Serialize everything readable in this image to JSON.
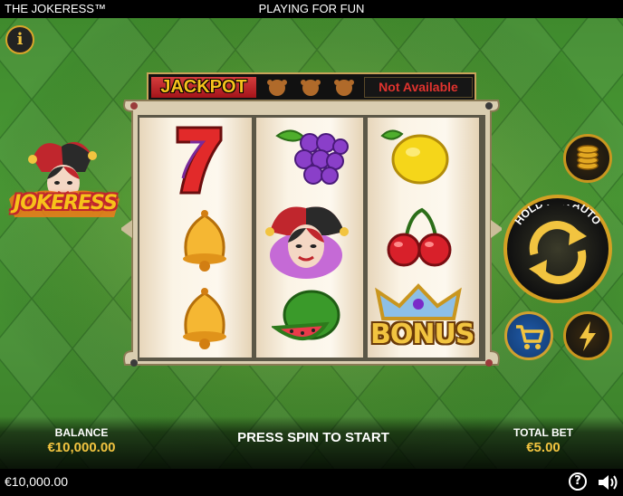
{
  "header": {
    "game_title": "THE JOKERESS™",
    "mode_label": "PLAYING FOR FUN"
  },
  "info_button": {
    "icon": "info-icon",
    "glyph": "i"
  },
  "logo": {
    "text": "JOKERESS",
    "prefix": ""
  },
  "jackpot": {
    "label": "JACKPOT",
    "status": "Not Available"
  },
  "reels": [
    [
      "seven",
      "bell",
      "bell"
    ],
    [
      "grapes",
      "jokeress",
      "watermelon"
    ],
    [
      "lemon",
      "cherries",
      "bonus"
    ]
  ],
  "bonus_symbol_text": "BONUS",
  "controls": {
    "coins_icon": "coin-stack-icon",
    "auto_label": "HOLD FOR AUTO",
    "auto_icon": "spin-arrows-icon",
    "cart_icon": "cart-icon",
    "bolt_icon": "lightning-icon"
  },
  "footer": {
    "balance_label": "BALANCE",
    "balance_value": "€10,000.00",
    "prompt": "PRESS SPIN TO START",
    "bet_label": "TOTAL BET",
    "bet_value": "€5.00"
  },
  "statusbar": {
    "balance": "€10,000.00",
    "help_glyph": "?"
  },
  "colors": {
    "felt_green": "#4a9a35",
    "gold": "#d4a023",
    "jackpot_red": "#c0262d",
    "status_red": "#e0332e"
  }
}
